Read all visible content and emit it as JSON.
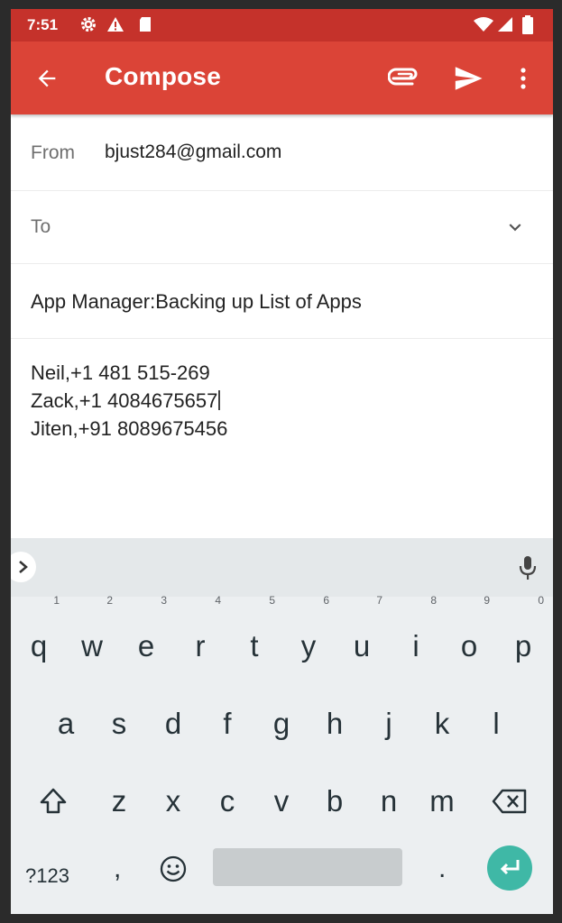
{
  "status_bar": {
    "time": "7:51"
  },
  "app_bar": {
    "title": "Compose"
  },
  "from": {
    "label": "From",
    "value": "bjust284@gmail.com"
  },
  "to": {
    "label": "To"
  },
  "subject": "App Manager:Backing up List of Apps",
  "body": {
    "lines": [
      "Neil,+1 481 515-269",
      "Zack,+1 4084675657",
      "Jiten,+91 8089675456"
    ]
  },
  "keyboard": {
    "row1": [
      {
        "key": "q",
        "hint": "1"
      },
      {
        "key": "w",
        "hint": "2"
      },
      {
        "key": "e",
        "hint": "3"
      },
      {
        "key": "r",
        "hint": "4"
      },
      {
        "key": "t",
        "hint": "5"
      },
      {
        "key": "y",
        "hint": "6"
      },
      {
        "key": "u",
        "hint": "7"
      },
      {
        "key": "i",
        "hint": "8"
      },
      {
        "key": "o",
        "hint": "9"
      },
      {
        "key": "p",
        "hint": "0"
      }
    ],
    "row2": [
      "a",
      "s",
      "d",
      "f",
      "g",
      "h",
      "j",
      "k",
      "l"
    ],
    "row3": [
      "z",
      "x",
      "c",
      "v",
      "b",
      "n",
      "m"
    ],
    "symbols_label": "?123",
    "comma": ",",
    "period": "."
  },
  "colors": {
    "app_bar": "#db4437",
    "status_bar": "#c5322b",
    "enter_key": "#3fb8a6",
    "keyboard_bg": "#eceff1"
  },
  "icons": [
    "settings-icon",
    "warning-icon",
    "sd-card-icon",
    "wifi-icon",
    "signal-icon",
    "battery-icon",
    "back-arrow-icon",
    "attach-icon",
    "send-icon",
    "more-vert-icon",
    "chevron-down-icon",
    "expand-suggestions-icon",
    "mic-icon",
    "shift-icon",
    "backspace-icon",
    "emoji-icon",
    "enter-icon"
  ]
}
